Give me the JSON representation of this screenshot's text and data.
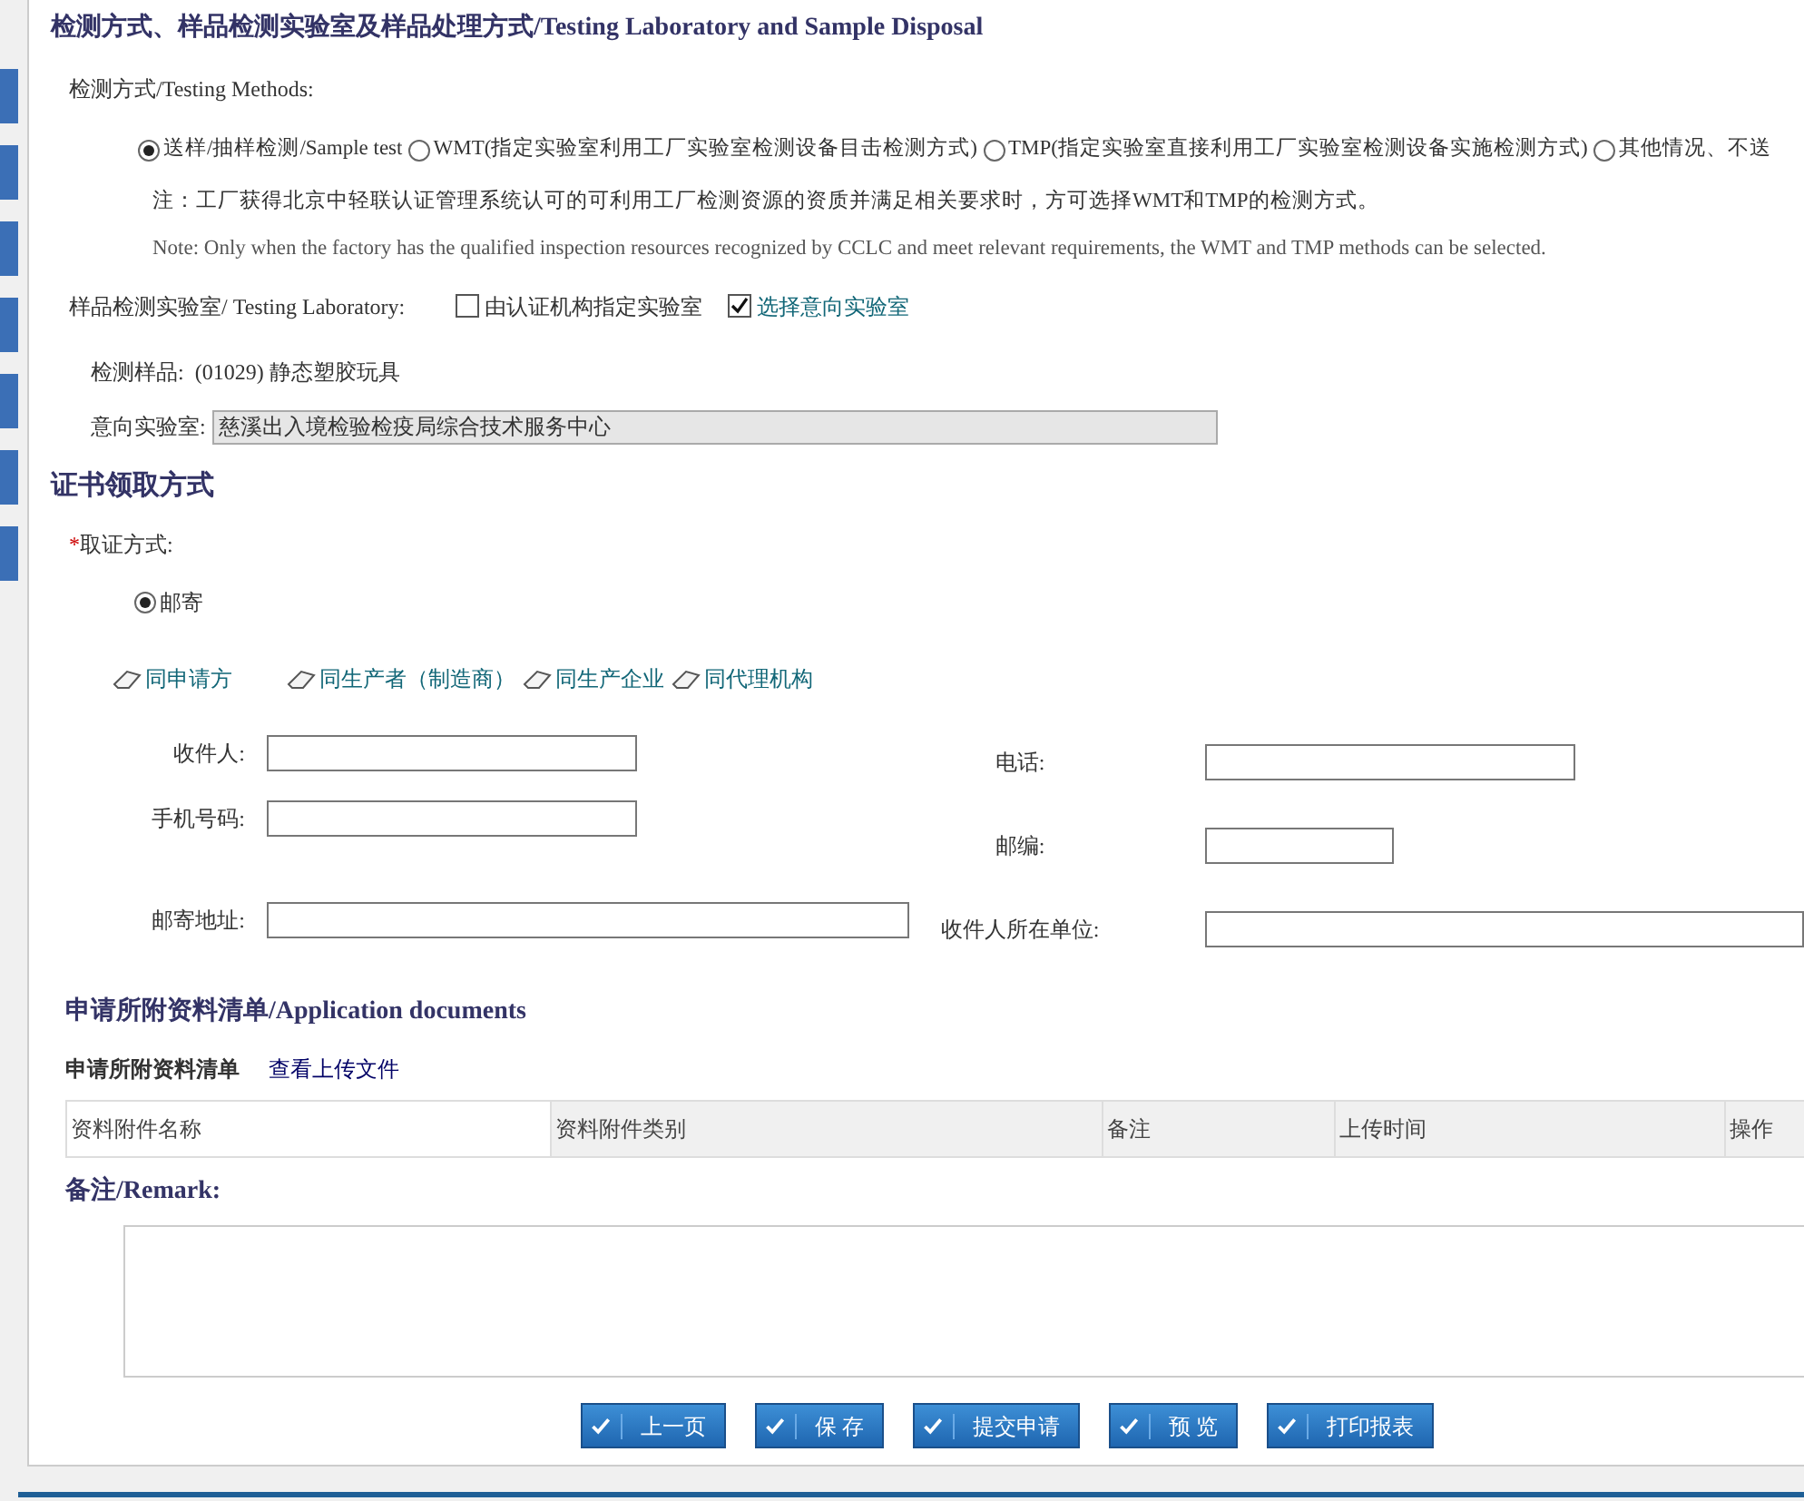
{
  "section_title": "检测方式、样品检测实验室及样品处理方式/Testing Laboratory and Sample Disposal",
  "testing_methods": {
    "label": "检测方式/Testing Methods:",
    "options": [
      {
        "label": "送样/抽样检测/Sample test",
        "selected": true
      },
      {
        "label": "WMT(指定实验室利用工厂实验室检测设备目击检测方式)",
        "selected": false
      },
      {
        "label": "TMP(指定实验室直接利用工厂实验室检测设备实施检测方式)",
        "selected": false
      },
      {
        "label": "其他情况、不送",
        "selected": false
      }
    ],
    "note_cn": "注：工厂获得北京中轻联认证管理系统认可的可利用工厂检测资源的资质并满足相关要求时，方可选择WMT和TMP的检测方式。",
    "note_en": "Note: Only when the factory has the qualified inspection resources recognized by CCLC and meet relevant requirements, the WMT and TMP methods can be selected."
  },
  "laboratory": {
    "label": "样品检测实验室/ Testing Laboratory:",
    "options": [
      {
        "label": "由认证机构指定实验室",
        "checked": false
      },
      {
        "label": "选择意向实验室",
        "checked": true
      }
    ]
  },
  "sample": {
    "label": "检测样品:",
    "value": "(01029) 静态塑胶玩具"
  },
  "intended_lab": {
    "label": "意向实验室:",
    "value": "慈溪出入境检验检疫局综合技术服务中心"
  },
  "certificate": {
    "title": "证书领取方式",
    "required_mark": "*",
    "label": "取证方式:",
    "options": [
      {
        "label": "邮寄",
        "selected": true
      }
    ],
    "copy_links": [
      "同申请方",
      "同生产者（制造商）",
      "同生产企业",
      "同代理机构"
    ],
    "fields_left": [
      {
        "label": "收件人:"
      },
      {
        "label": "手机号码:"
      },
      {
        "label": "邮寄地址:"
      }
    ],
    "fields_right": [
      {
        "label": "电话:"
      },
      {
        "label": "邮编:"
      },
      {
        "label": "收件人所在单位:"
      }
    ]
  },
  "documents": {
    "title": "申请所附资料清单/Application documents",
    "subtitle": "申请所附资料清单",
    "link": "查看上传文件",
    "columns": [
      "资料附件名称",
      "资料附件类别",
      "备注",
      "上传时间",
      "操作"
    ]
  },
  "remark": {
    "title": "备注/Remark:"
  },
  "buttons": [
    "上一页",
    "保 存",
    "提交申请",
    "预 览",
    "打印报表"
  ]
}
